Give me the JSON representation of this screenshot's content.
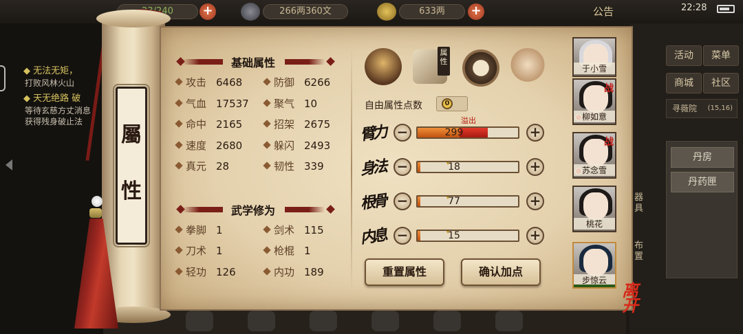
{
  "topbar": {
    "stamina": "23/240",
    "money": "266两360文",
    "gold": "633两",
    "notice": "公告",
    "time": "22:28"
  },
  "background": {
    "quest1": "无法无矩，",
    "quest1_sub": "打败风林火山",
    "quest2": "天无绝路 破",
    "quest2_sub1": "等待玄慈方丈消息",
    "quest2_sub2": "获得残身破止法",
    "menu": [
      "活动",
      "菜单",
      "商城",
      "社区"
    ],
    "map_label": "寻薇院",
    "map_coord": "(15,16)",
    "side_items": [
      "丹房",
      "丹药匣"
    ],
    "side_label_a": "器具",
    "side_label_b": "布置"
  },
  "scroll": {
    "label_chars": [
      "屬",
      "性"
    ]
  },
  "basic_attrs": {
    "title": "基础属性",
    "left": [
      {
        "label": "攻击",
        "value": "6468"
      },
      {
        "label": "气血",
        "value": "17537"
      },
      {
        "label": "命中",
        "value": "2165"
      },
      {
        "label": "速度",
        "value": "2680"
      },
      {
        "label": "真元",
        "value": "28"
      }
    ],
    "right": [
      {
        "label": "防御",
        "value": "6266"
      },
      {
        "label": "聚气",
        "value": "10"
      },
      {
        "label": "招架",
        "value": "2675"
      },
      {
        "label": "躲闪",
        "value": "2493"
      },
      {
        "label": "韧性",
        "value": "339"
      }
    ]
  },
  "martial": {
    "title": "武学修为",
    "left": [
      {
        "label": "拳脚",
        "value": "1"
      },
      {
        "label": "刀术",
        "value": "1"
      },
      {
        "label": "轻功",
        "value": "126"
      }
    ],
    "right": [
      {
        "label": "剑术",
        "value": "115"
      },
      {
        "label": "枪棍",
        "value": "1"
      },
      {
        "label": "内功",
        "value": "189"
      }
    ]
  },
  "tabs": {
    "active_tag": "属性"
  },
  "free_points": {
    "label": "自由属性点数",
    "value": "0"
  },
  "attributes": [
    {
      "name": "臂力",
      "value": "299",
      "fill": 0.42,
      "overflow": 0.28,
      "overflow_label": "溢出"
    },
    {
      "name": "身法",
      "value": "18",
      "fill": 0.03
    },
    {
      "name": "根骨",
      "value": "77",
      "fill": 0.03
    },
    {
      "name": "内息",
      "value": "15",
      "fill": 0.03
    }
  ],
  "buttons": {
    "reset": "重置属性",
    "confirm": "确认加点"
  },
  "characters": [
    {
      "name": "于小雪",
      "war": ""
    },
    {
      "name": "柳如意",
      "war": "战"
    },
    {
      "name": "苏念雪",
      "war": "战"
    },
    {
      "name": "桃花",
      "war": ""
    },
    {
      "name": "步惊云",
      "war": ""
    }
  ],
  "leave": "离开",
  "colors": {
    "accent_red": "#7a1f18",
    "bar_fill": "#e07a26",
    "bar_overflow": "#c0281a"
  }
}
